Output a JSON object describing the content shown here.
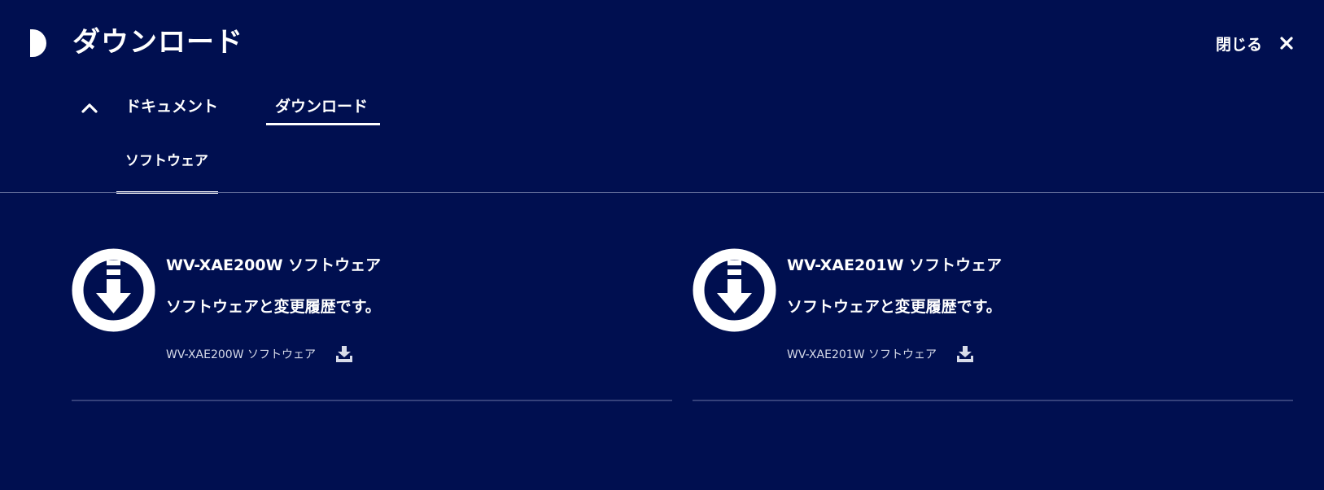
{
  "header": {
    "title": "ダウンロード",
    "close_label": "閉じる",
    "logo_icon": "half-circle-icon",
    "close_icon": "close-icon"
  },
  "tabs": [
    {
      "label": "ドキュメント",
      "active": false
    },
    {
      "label": "ダウンロード",
      "active": true
    }
  ],
  "subtabs": [
    {
      "label": "ソフトウェア",
      "active": true
    }
  ],
  "cards": [
    {
      "title": "WV-XAE200W ソフトウェア",
      "description": "ソフトウェアと変更履歴です。",
      "link_label": "WV-XAE200W ソフトウェア",
      "icon": "download-circle-icon",
      "link_icon": "download-tray-icon"
    },
    {
      "title": "WV-XAE201W ソフトウェア",
      "description": "ソフトウェアと変更履歴です。",
      "link_label": "WV-XAE201W ソフトウェア",
      "icon": "download-circle-icon",
      "link_icon": "download-tray-icon"
    }
  ],
  "colors": {
    "background": "#000f50",
    "text": "#ffffff",
    "divider": "#5a6594",
    "card_divider": "#35417a",
    "link_text": "#d7dbe9"
  }
}
